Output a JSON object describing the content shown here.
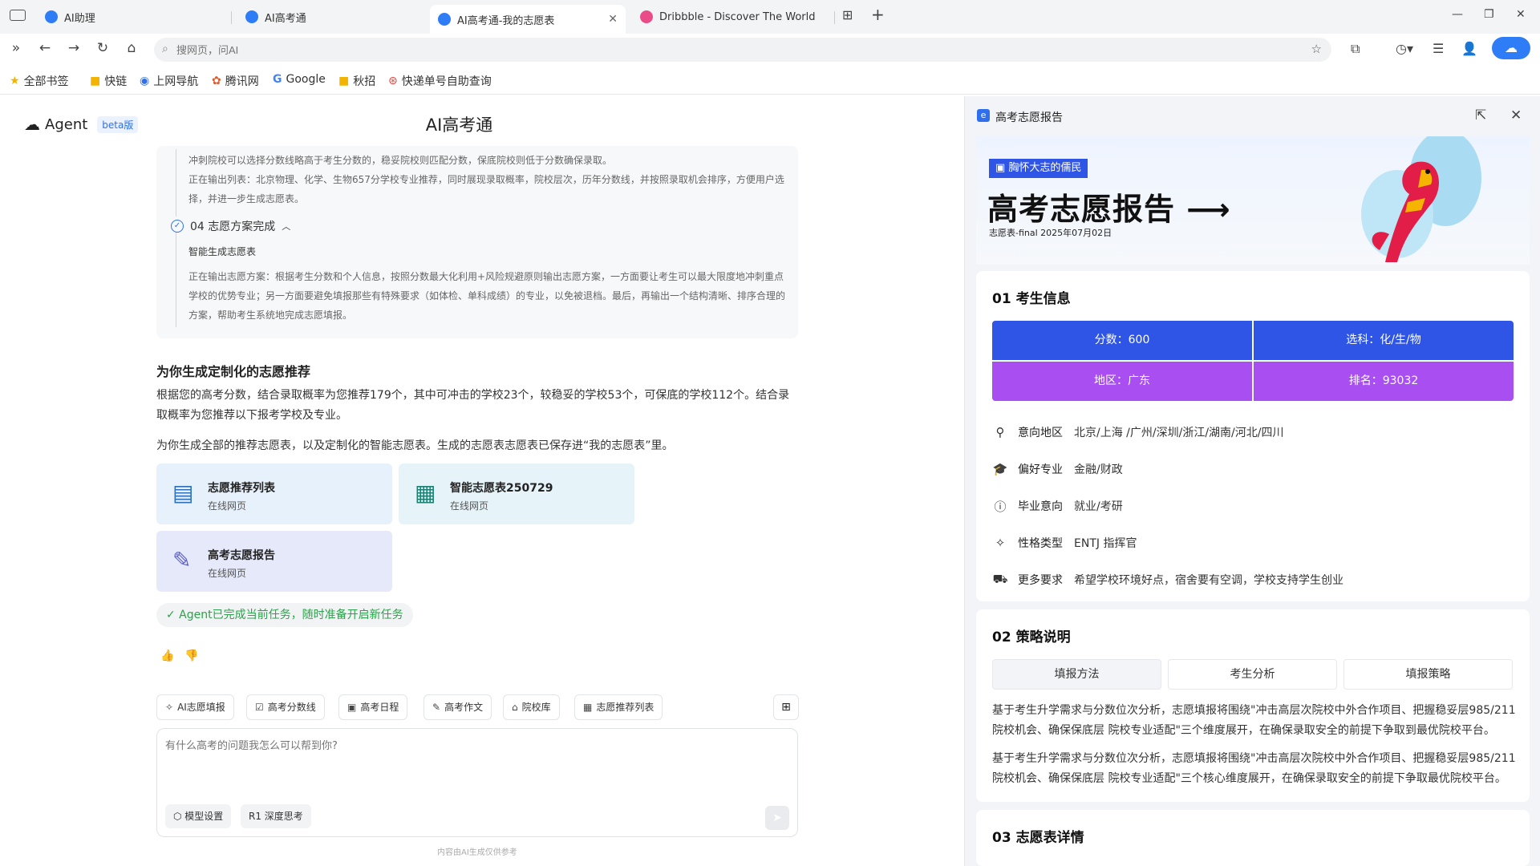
{
  "browser": {
    "tabs": [
      {
        "label": "AI助理"
      },
      {
        "label": "AI高考通"
      },
      {
        "label": "AI高考通-我的志愿表"
      },
      {
        "label": "Dribbble - Discover The World"
      }
    ],
    "address_placeholder": "搜网页，问AI",
    "bookmarks": [
      {
        "label": "全部书签"
      },
      {
        "label": "快链"
      },
      {
        "label": "上网导航"
      },
      {
        "label": "腾讯网"
      },
      {
        "label": "Google"
      },
      {
        "label": "秋招"
      },
      {
        "label": "快递单号自助查询"
      }
    ]
  },
  "agent": {
    "logo": "Agent",
    "badge": "beta版",
    "page_title": "AI高考通",
    "thinking": {
      "line1": "冲刺院校可以选择分数线略高于考生分数的，稳妥院校则匹配分数，保底院校则低于分数确保录取。",
      "line2": "正在输出列表：北京物理、化学、生物657分学校专业推荐，同时展现录取概率，院校层次，历年分数线，并按照录取机会排序，方便用户选",
      "line3": "择，并进一步生成志愿表。",
      "step_label": "04  志愿方案完成",
      "step_sub": "智能生成志愿表",
      "step_text1": "正在输出志愿方案：根据考生分数和个人信息，按照分数最大化利用+风险规避原则输出志愿方案，一方面要让考生可以最大限度地冲刺重点",
      "step_text2": "学校的优势专业；另一方面要避免填报那些有特殊要求（如体检、单科成绩）的专业，以免被退档。最后，再输出一个结构清晰、排序合理的",
      "step_text3": "方案，帮助考生系统地完成志愿填报。"
    },
    "result_title": "为你生成定制化的志愿推荐",
    "result_para1": "根据您的高考分数，结合录取概率为您推荐179个，其中可冲击的学校23个，较稳妥的学校53个，可保底的学校112个。结合录取概率为您推荐以下报考学校及专业。",
    "result_para2": "为你生成全部的推荐志愿表，以及定制化的智能志愿表。生成的志愿表志愿表已保存进“我的志愿表”里。",
    "cards": [
      {
        "title": "志愿推荐列表",
        "sub": "在线网页"
      },
      {
        "title": "智能志愿表250729",
        "sub": "在线网页"
      },
      {
        "title": "高考志愿报告",
        "sub": "在线网页"
      }
    ],
    "done_text": "✓ Agent已完成当前任务，随时准备开启新任务",
    "quick_chips": [
      {
        "label": "AI志愿填报"
      },
      {
        "label": "高考分数线"
      },
      {
        "label": "高考日程"
      },
      {
        "label": "高考作文"
      },
      {
        "label": "院校库"
      },
      {
        "label": "志愿推荐列表"
      }
    ],
    "composer_placeholder": "有什么高考的问题我怎么可以帮到你?",
    "model_setting": "模型设置",
    "deep_think": "R1 深度思考",
    "disclaimer": "内容由AI生成仅供参考"
  },
  "report": {
    "panel_title": "高考志愿报告",
    "hero_tag": "胸怀大志的儒民",
    "hero_title": "高考志愿报告 ⟶",
    "hero_sub": "志愿表-final    2025年07月02日",
    "s1_title": "01 考生信息",
    "grid": [
      {
        "text": "分数：600",
        "color": "#2f55e6"
      },
      {
        "text": "选科：化/生/物",
        "color": "#2f55e6"
      },
      {
        "text": "地区：广东",
        "color": "#a94ef0"
      },
      {
        "text": "排名：93032",
        "color": "#a94ef0"
      }
    ],
    "info": [
      {
        "icon": "location-icon",
        "label": "意向地区",
        "value": "北京/上海 /广州/深圳/浙江/湖南/河北/四川"
      },
      {
        "icon": "graduation-cap-icon",
        "label": "偏好专业",
        "value": "金融/财政"
      },
      {
        "icon": "info-icon",
        "label": "毕业意向",
        "value": "就业/考研"
      },
      {
        "icon": "sparkle-icon",
        "label": "性格类型",
        "value": "ENTJ 指挥官"
      },
      {
        "icon": "car-icon",
        "label": "更多要求",
        "value": "希望学校环境好点，宿舍要有空调，学校支持学生创业"
      }
    ],
    "s2_title": "02 策略说明",
    "strategy_tabs": [
      {
        "label": "填报方法"
      },
      {
        "label": "考生分析"
      },
      {
        "label": "填报策略"
      }
    ],
    "strategy_p1": "基于考生升学需求与分数位次分析，志愿填报将围绕\"冲击高层次院校中外合作项目、把握稳妥层985/211院校机会、确保保底层 院校专业适配\"三个维度展开，在确保录取安全的前提下争取到最优院校平台。",
    "strategy_p2": "基于考生升学需求与分数位次分析，志愿填报将围绕\"冲击高层次院校中外合作项目、把握稳妥层985/211院校机会、确保保底层 院校专业适配\"三个核心维度展开，在确保录取安全的前提下争取最优院校平台。",
    "s3_title": "03 志愿表详情"
  }
}
